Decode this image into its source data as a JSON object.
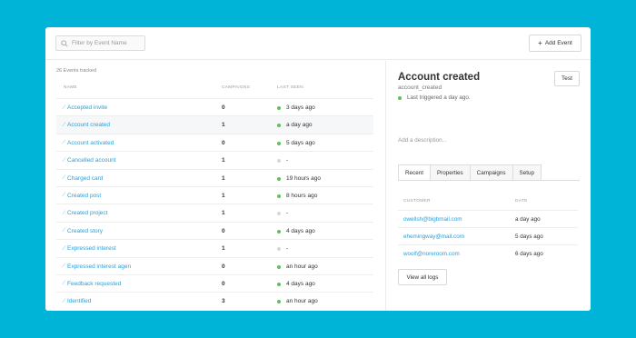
{
  "search": {
    "placeholder": "Filter by Event Name"
  },
  "header": {
    "add_event_label": "Add Event",
    "add_event_icon": "+"
  },
  "events": {
    "count_text": "26 Events tracked",
    "columns": [
      "NAME",
      "CAMPAIGNS",
      "LAST SEEN"
    ],
    "rows": [
      {
        "name": "Accepted invite",
        "campaigns": "0",
        "last_seen": "3 days ago",
        "status": "green"
      },
      {
        "name": "Account created",
        "campaigns": "1",
        "last_seen": "a day ago",
        "status": "green",
        "selected": true
      },
      {
        "name": "Account activated",
        "campaigns": "0",
        "last_seen": "5 days ago",
        "status": "green"
      },
      {
        "name": "Cancelled account",
        "campaigns": "1",
        "last_seen": "-",
        "status": "grey"
      },
      {
        "name": "Charged card",
        "campaigns": "1",
        "last_seen": "19 hours ago",
        "status": "green"
      },
      {
        "name": "Created post",
        "campaigns": "1",
        "last_seen": "8 hours ago",
        "status": "green"
      },
      {
        "name": "Created project",
        "campaigns": "1",
        "last_seen": "-",
        "status": "grey"
      },
      {
        "name": "Created story",
        "campaigns": "0",
        "last_seen": "4 days ago",
        "status": "green"
      },
      {
        "name": "Expressed interest",
        "campaigns": "1",
        "last_seen": "-",
        "status": "grey"
      },
      {
        "name": "Expressed interest agen",
        "campaigns": "0",
        "last_seen": "an hour ago",
        "status": "green"
      },
      {
        "name": "Feedback requested",
        "campaigns": "0",
        "last_seen": "4 days ago",
        "status": "green"
      },
      {
        "name": "Identified",
        "campaigns": "3",
        "last_seen": "an hour ago",
        "status": "green"
      }
    ]
  },
  "detail": {
    "title": "Account created",
    "key": "account_created",
    "test_label": "Test",
    "last_triggered": "Last triggered a day ago.",
    "description_placeholder": "Add a description...",
    "tabs": [
      "Recent",
      "Properties",
      "Campaigns",
      "Setup"
    ],
    "columns": [
      "CUSTOMER",
      "DATE"
    ],
    "recent": [
      {
        "email": "owellsh@bigbmail.com",
        "date": "a day ago"
      },
      {
        "email": "ehemingway@mail.com",
        "date": "5 days ago"
      },
      {
        "email": "woolf@noreroom.com",
        "date": "6 days ago"
      }
    ],
    "view_logs_label": "View all logs"
  },
  "colors": {
    "background": "#00b4d8",
    "link": "#2b9fd6",
    "status_green": "#5bc35b",
    "status_grey": "#d7d7d7"
  }
}
